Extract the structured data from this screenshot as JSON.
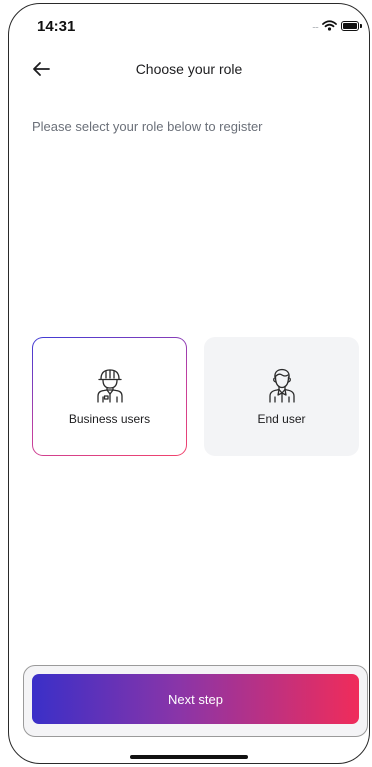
{
  "status_bar": {
    "time": "14:31",
    "signal": "....",
    "icons": [
      "wifi-icon",
      "battery-icon"
    ]
  },
  "header": {
    "title": "Choose your role",
    "back_icon": "arrow-left-icon"
  },
  "subtitle": "Please select your role below to register",
  "roles": [
    {
      "label": "Business users",
      "icon": "worker-helmet-icon",
      "selected": true
    },
    {
      "label": "End user",
      "icon": "person-icon",
      "selected": false
    }
  ],
  "next_button": {
    "label": "Next step"
  },
  "colors": {
    "gradient_start": "#3a2fc8",
    "gradient_end": "#f02c5a",
    "card_unselected_bg": "#f3f4f6",
    "subtitle_text": "#6b7079"
  }
}
